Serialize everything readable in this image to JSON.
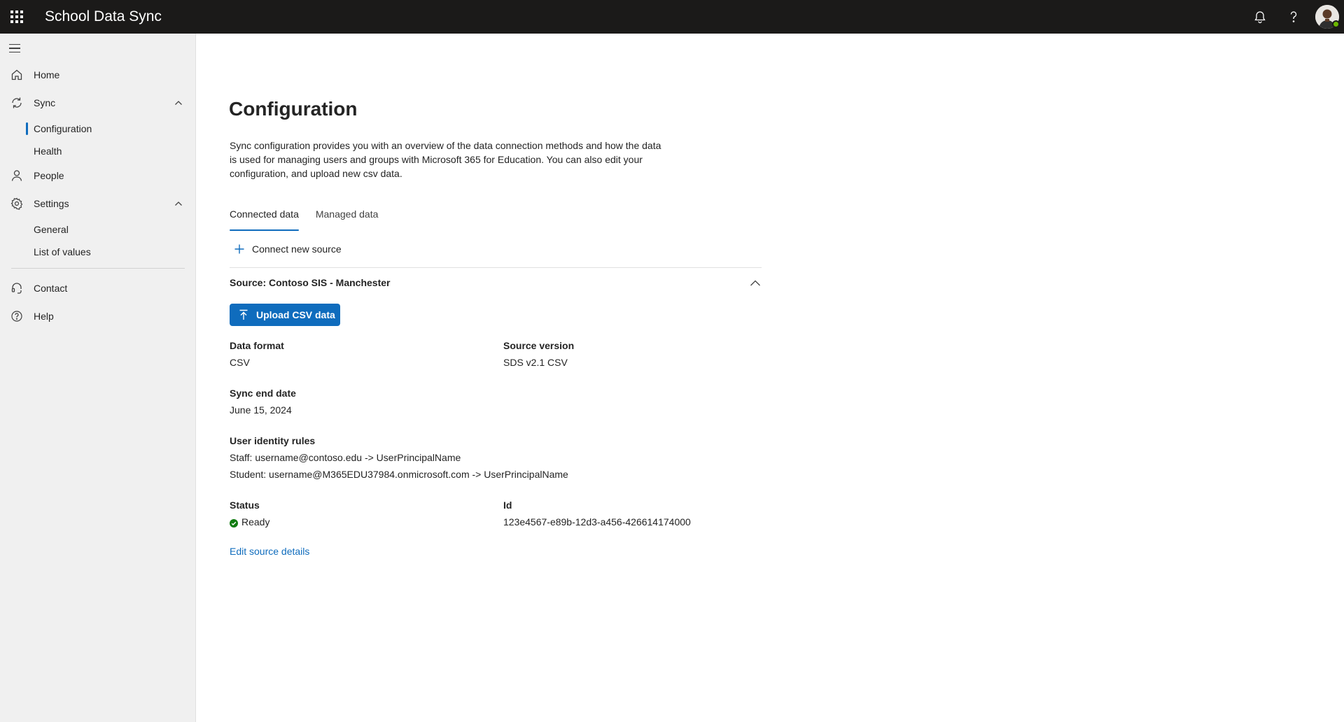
{
  "app": {
    "title": "School Data Sync"
  },
  "sidebar": {
    "items": [
      {
        "label": "Home",
        "icon": "home-icon"
      },
      {
        "label": "Sync",
        "icon": "sync-icon",
        "expanded": true
      },
      {
        "label": "People",
        "icon": "person-icon"
      },
      {
        "label": "Settings",
        "icon": "gear-icon",
        "expanded": true
      },
      {
        "label": "Contact",
        "icon": "headset-icon"
      },
      {
        "label": "Help",
        "icon": "question-circle-icon"
      }
    ],
    "sync_children": [
      "Configuration",
      "Health"
    ],
    "settings_children": [
      "General",
      "List of values"
    ],
    "selected": "Configuration"
  },
  "page": {
    "title": "Configuration",
    "description": "Sync configuration provides you with an overview of the data connection methods and how the data is used for managing users and groups with Microsoft 365 for Education. You can also edit your configuration, and upload new csv data.",
    "tabs": [
      {
        "label": "Connected data",
        "active": true
      },
      {
        "label": "Managed data",
        "active": false
      }
    ],
    "connect_button": "Connect new source"
  },
  "source": {
    "title": "Source: Contoso SIS - Manchester",
    "upload_button": "Upload CSV data",
    "data_format_label": "Data format",
    "data_format_value": "CSV",
    "source_version_label": "Source version",
    "source_version_value": "SDS v2.1 CSV",
    "sync_end_label": "Sync end date",
    "sync_end_value": "June 15, 2024",
    "identity_rules_label": "User identity rules",
    "identity_rules": [
      "Staff: username@contoso.edu -> UserPrincipalName",
      "Student: username@M365EDU37984.onmicrosoft.com -> UserPrincipalName"
    ],
    "status_label": "Status",
    "status_value": "Ready",
    "id_label": "Id",
    "id_value": "123e4567-e89b-12d3-a456-426614174000",
    "edit_link": "Edit source details"
  },
  "colors": {
    "topbar": "#1b1a19",
    "sidebar": "#f0f0f0",
    "accent": "#0f6cbd",
    "success": "#107c10"
  }
}
